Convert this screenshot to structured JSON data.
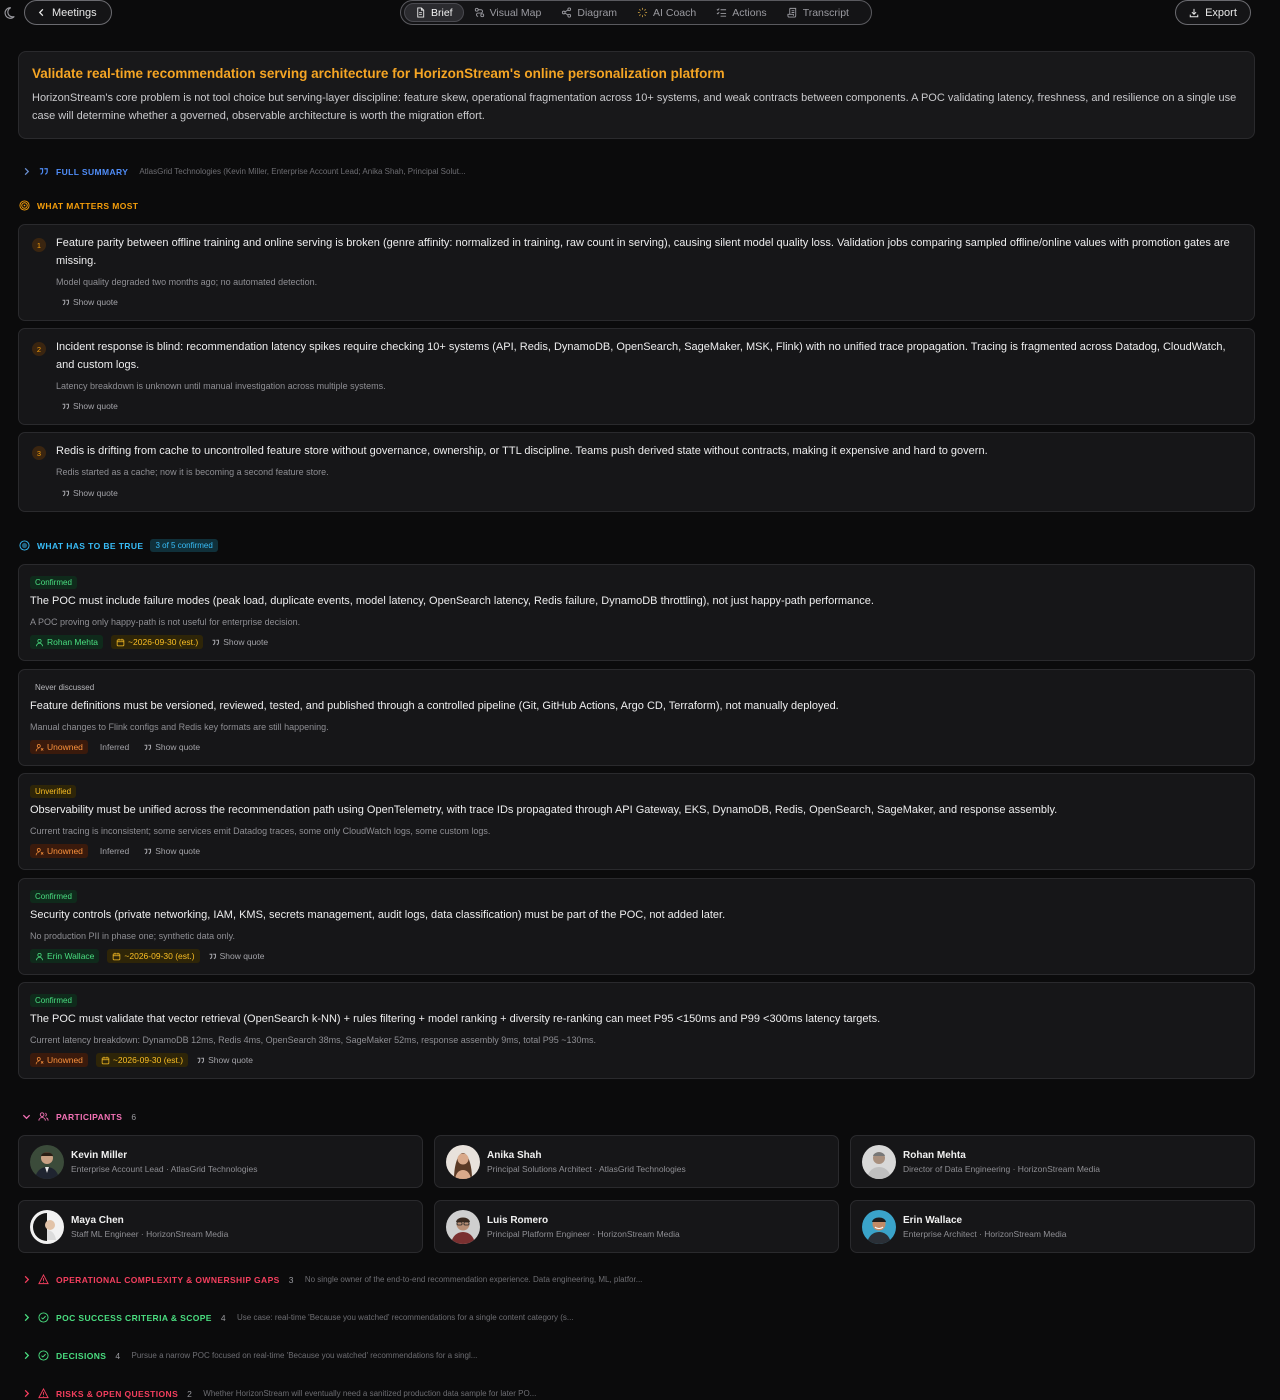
{
  "topbar": {
    "back_label": "Meetings",
    "export_label": "Export",
    "tabs": [
      {
        "label": "Brief",
        "icon": "document-icon"
      },
      {
        "label": "Visual Map",
        "icon": "route-icon"
      },
      {
        "label": "Diagram",
        "icon": "share-nodes-icon"
      },
      {
        "label": "AI Coach",
        "icon": "spinner-icon"
      },
      {
        "label": "Actions",
        "icon": "list-check-icon"
      },
      {
        "label": "Transcript",
        "icon": "scroll-icon"
      }
    ],
    "active_tab": "Brief"
  },
  "hero": {
    "title": "Validate real-time recommendation serving architecture for HorizonStream's online personalization platform",
    "body": "HorizonStream's core problem is not tool choice but serving-layer discipline: feature skew, operational fragmentation across 10+ systems, and weak contracts between components. A POC validating latency, freshness, and resilience on a single use case will determine whether a governed, observable architecture is worth the migration effort."
  },
  "full_summary": {
    "label": "FULL SUMMARY",
    "preview": "AtlasGrid Technologies (Kevin Miller, Enterprise Account Lead; Anika Shah, Principal Solut..."
  },
  "matters": {
    "label": "WHAT MATTERS MOST",
    "quote_label": "Show quote",
    "items": [
      {
        "num": "1",
        "title": "Feature parity between offline training and online serving is broken (genre affinity: normalized in training, raw count in serving), causing silent model quality loss. Validation jobs comparing sampled offline/online values with promotion gates are missing.",
        "sub": "Model quality degraded two months ago; no automated detection."
      },
      {
        "num": "2",
        "title": "Incident response is blind: recommendation latency spikes require checking 10+ systems (API, Redis, DynamoDB, OpenSearch, SageMaker, MSK, Flink) with no unified trace propagation. Tracing is fragmented across Datadog, CloudWatch, and custom logs.",
        "sub": "Latency breakdown is unknown until manual investigation across multiple systems."
      },
      {
        "num": "3",
        "title": "Redis is drifting from cache to uncontrolled feature store without governance, ownership, or TTL discipline. Teams push derived state without contracts, making it expensive and hard to govern.",
        "sub": "Redis started as a cache; now it is becoming a second feature store."
      }
    ]
  },
  "true": {
    "label": "WHAT HAS TO BE TRUE",
    "confirmed_badge": "3 of 5 confirmed",
    "quote_label": "Show quote",
    "items": [
      {
        "status": "Confirmed",
        "title": "The POC must include failure modes (peak load, duplicate events, model latency, OpenSearch latency, Redis failure, DynamoDB throttling), not just happy-path performance.",
        "sub": "A POC proving only happy-path is not useful for enterprise decision.",
        "owner": "Rohan Mehta",
        "date": "~2026-09-30 (est.)",
        "inferred": ""
      },
      {
        "status": "Never discussed",
        "title": "Feature definitions must be versioned, reviewed, tested, and published through a controlled pipeline (Git, GitHub Actions, Argo CD, Terraform), not manually deployed.",
        "sub": "Manual changes to Flink configs and Redis key formats are still happening.",
        "owner": "Unowned",
        "date": "",
        "inferred": "Inferred"
      },
      {
        "status": "Unverified",
        "title": "Observability must be unified across the recommendation path using OpenTelemetry, with trace IDs propagated through API Gateway, EKS, DynamoDB, Redis, OpenSearch, SageMaker, and response assembly.",
        "sub": "Current tracing is inconsistent; some services emit Datadog traces, some only CloudWatch logs, some custom logs.",
        "owner": "Unowned",
        "date": "",
        "inferred": "Inferred"
      },
      {
        "status": "Confirmed",
        "title": "Security controls (private networking, IAM, KMS, secrets management, audit logs, data classification) must be part of the POC, not added later.",
        "sub": "No production PII in phase one; synthetic data only.",
        "owner": "Erin Wallace",
        "date": "~2026-09-30 (est.)",
        "inferred": ""
      },
      {
        "status": "Confirmed",
        "title": "The POC must validate that vector retrieval (OpenSearch k-NN) + rules filtering + model ranking + diversity re-ranking can meet P95 <150ms and P99 <300ms latency targets.",
        "sub": "Current latency breakdown: DynamoDB 12ms, Redis 4ms, OpenSearch 38ms, SageMaker 52ms, response assembly 9ms, total P95 ~130ms.",
        "owner": "Unowned",
        "date": "~2026-09-30 (est.)",
        "inferred": ""
      }
    ]
  },
  "participants": {
    "label": "PARTICIPANTS",
    "count": "6",
    "people": [
      {
        "name": "Kevin Miller",
        "role": "Enterprise Account Lead · AtlasGrid Technologies"
      },
      {
        "name": "Anika Shah",
        "role": "Principal Solutions Architect · AtlasGrid Technologies"
      },
      {
        "name": "Rohan Mehta",
        "role": "Director of Data Engineering · HorizonStream Media"
      },
      {
        "name": "Maya Chen",
        "role": "Staff ML Engineer · HorizonStream Media"
      },
      {
        "name": "Luis Romero",
        "role": "Principal Platform Engineer · HorizonStream Media"
      },
      {
        "name": "Erin Wallace",
        "role": "Enterprise Architect · HorizonStream Media"
      }
    ]
  },
  "collapsed_sections": [
    {
      "label": "OPERATIONAL COMPLEXITY & OWNERSHIP GAPS",
      "count": "3",
      "preview": "No single owner of the end-to-end recommendation experience. Data engineering, ML, platfor..."
    },
    {
      "label": "POC SUCCESS CRITERIA & SCOPE",
      "count": "4",
      "preview": "Use case: real-time 'Because you watched' recommendations for a single content category (s..."
    },
    {
      "label": "DECISIONS",
      "count": "4",
      "preview": "Pursue a narrow POC focused on real-time 'Because you watched' recommendations for a singl..."
    },
    {
      "label": "RISKS & OPEN QUESTIONS",
      "count": "2",
      "preview": "Whether HorizonStream will eventually need a sanitized production data sample for later PO..."
    }
  ],
  "colors": {
    "accent": "#f5a524",
    "confirmed": "#4ade80",
    "unverified": "#fbbf24",
    "unowned": "#fb923c",
    "info": "#38bdf8",
    "risk": "#f43f5e"
  }
}
